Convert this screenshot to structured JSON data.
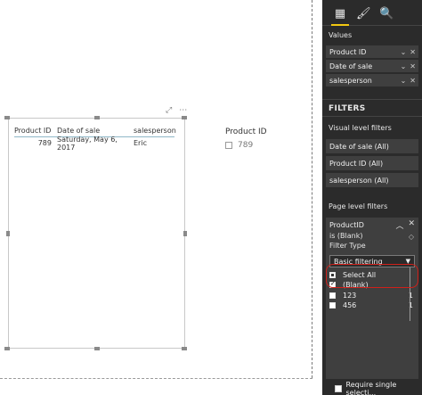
{
  "table": {
    "headers": [
      "Product ID",
      "Date of sale",
      "salesperson"
    ],
    "rows": [
      {
        "product_id": "789",
        "date_of_sale": "Saturday, May 6, 2017",
        "salesperson": "Eric"
      }
    ]
  },
  "slicer": {
    "title": "Product ID",
    "items": [
      "789"
    ]
  },
  "visual_header": {
    "focus_icon": "focus-mode-icon",
    "more_icon": "more-options-icon",
    "more_label": "⋯"
  },
  "pane": {
    "tabs": [
      "fields-grid-icon",
      "format-paint-roller-icon",
      "analytics-magnifier-icon"
    ],
    "values_label": "Values",
    "value_wells": [
      "Product ID",
      "Date of sale",
      "salesperson"
    ],
    "filters_title": "FILTERS",
    "visual_level_label": "Visual level filters",
    "visual_filters": [
      "Date of sale (All)",
      "Product ID (All)",
      "salesperson (All)"
    ],
    "page_level_label": "Page level filters",
    "page_filter": {
      "field": "ProductID",
      "condition": "is (Blank)",
      "filter_type_label": "Filter Type",
      "filter_type_value": "Basic filtering",
      "options": [
        {
          "label": "Select All",
          "count": "",
          "state": "partial"
        },
        {
          "label": "(Blank)",
          "count": "",
          "state": "checked"
        },
        {
          "label": "123",
          "count": "1",
          "state": "unchecked"
        },
        {
          "label": "456",
          "count": "1",
          "state": "unchecked"
        }
      ]
    },
    "require_single_label": "Require single selecti..."
  },
  "colors": {
    "pane_bg": "#2b2b2b",
    "card_bg": "#3f3f3f",
    "highlight": "#d0201a",
    "accent": "#f2c811"
  }
}
